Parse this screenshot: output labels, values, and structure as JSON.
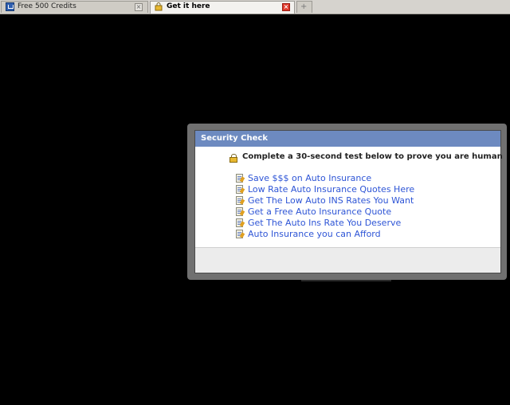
{
  "tabs": [
    {
      "label": "Free 500 Credits",
      "favicon": "blue-window-icon",
      "active": false
    },
    {
      "label": "Get it here",
      "favicon": "warning-lock-icon",
      "active": true
    }
  ],
  "dialog": {
    "title": "Security Check",
    "instruction": "Complete a 30-second test below to prove you are human",
    "offers": [
      "Save $$$ on Auto Insurance",
      "Low Rate Auto Insurance Quotes Here",
      "Get The Low Auto INS Rates You Want",
      "Get a Free Auto Insurance Quote",
      "Get The Auto Ins Rate You Deserve",
      "Auto Insurance you can Afford"
    ],
    "header_color": "#6d8ac0",
    "link_color": "#2e55d6"
  }
}
